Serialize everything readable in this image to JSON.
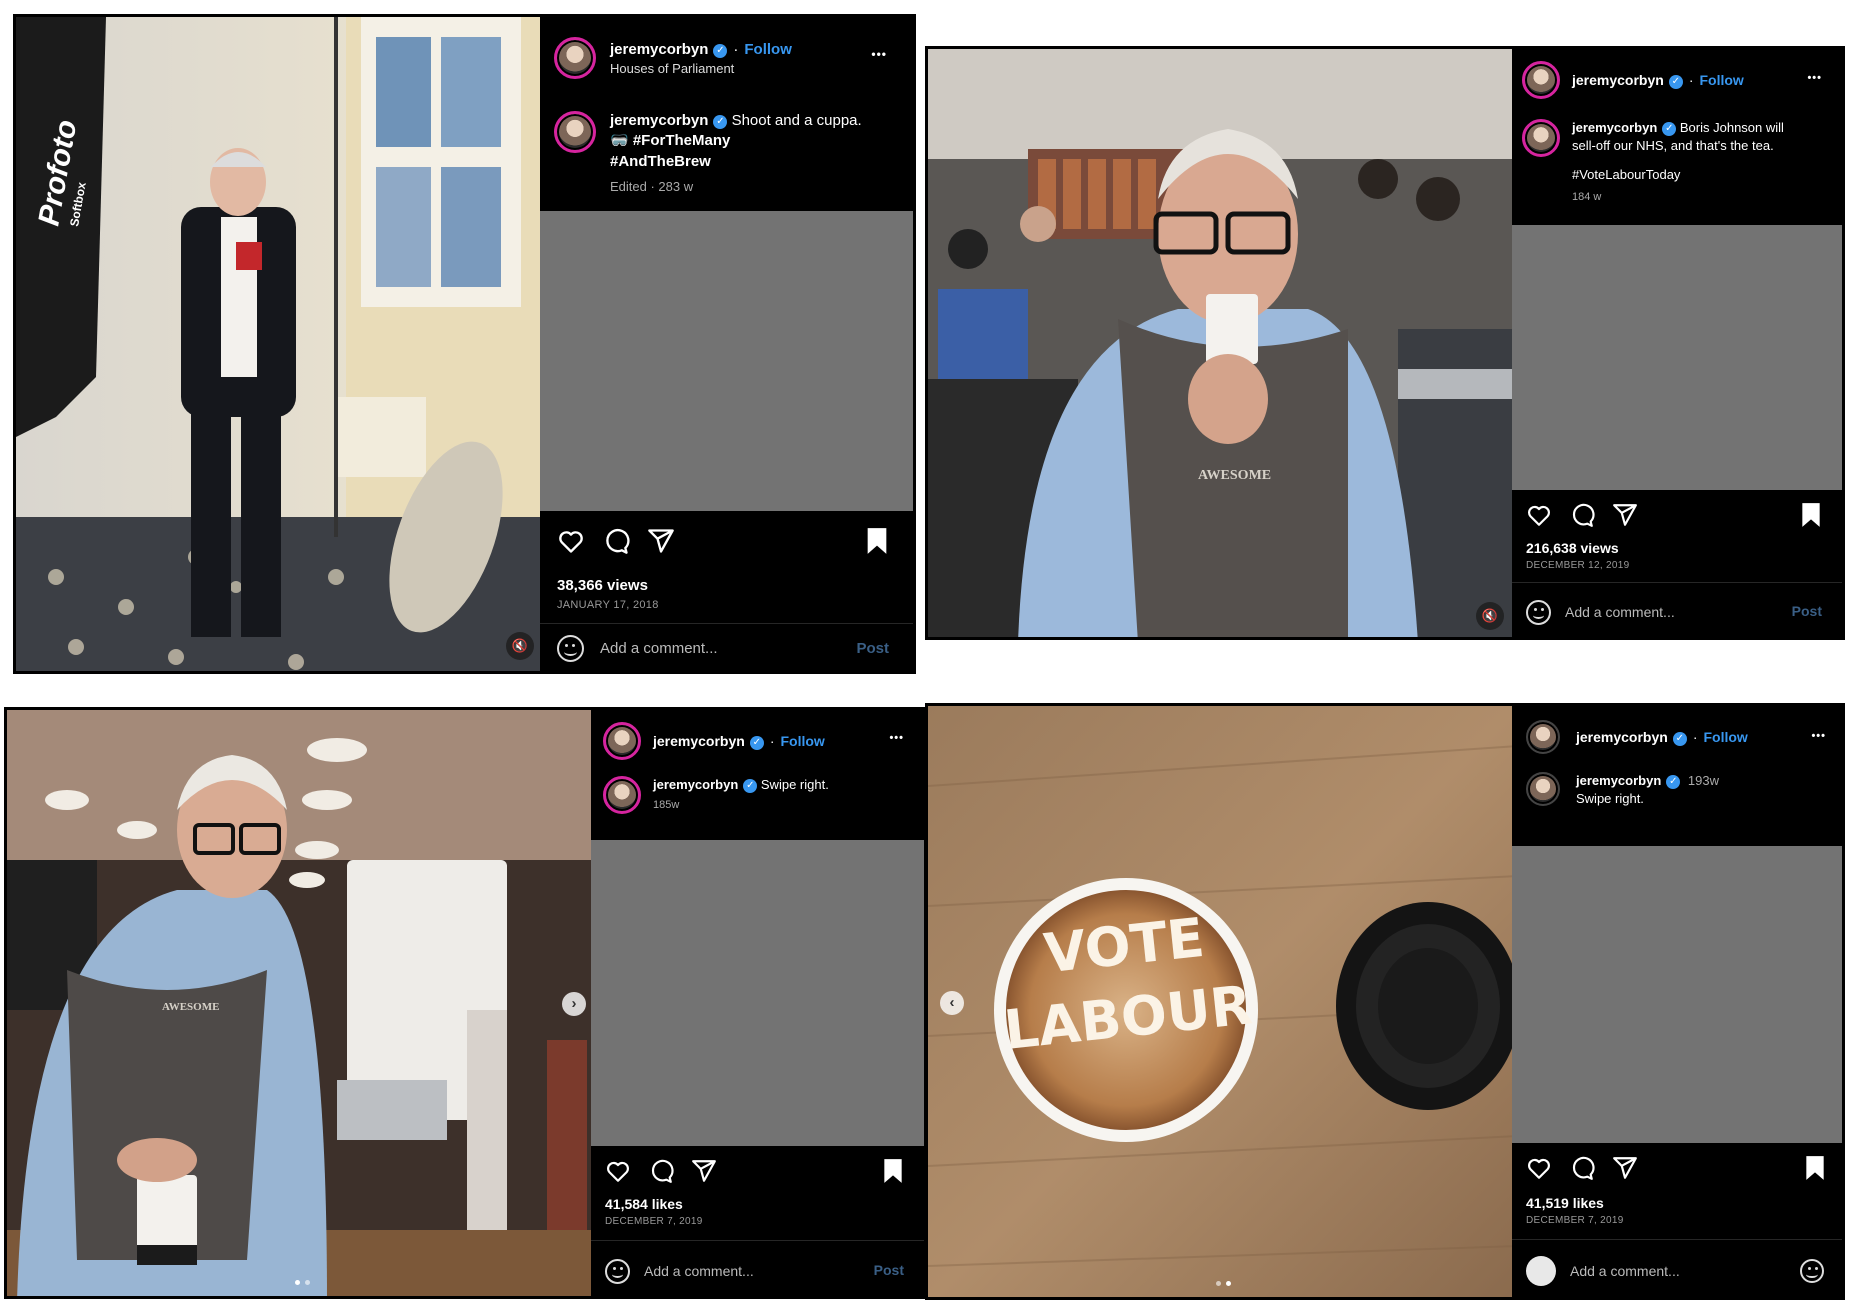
{
  "posts": [
    {
      "username": "jeremycorbyn",
      "follow_label": "Follow",
      "location": "Houses of Parliament",
      "more_label": "•••",
      "caption_lines": [
        "Shoot and a cuppa.",
        "🥽 #ForTheMany",
        "#AndTheBrew"
      ],
      "caption_meta": "Edited · 283 w",
      "stat": "38,366 views",
      "date": "JANUARY 17, 2018",
      "comment_placeholder": "Add a comment...",
      "post_label": "Post"
    },
    {
      "username": "jeremycorbyn",
      "follow_label": "Follow",
      "more_label": "•••",
      "caption_lines": [
        "Boris Johnson will",
        "sell-off our NHS, and that's the tea."
      ],
      "caption_hashtag": "#VoteLabourToday",
      "caption_meta": "184 w",
      "stat": "216,638 views",
      "date": "DECEMBER 12, 2019",
      "comment_placeholder": "Add a comment...",
      "post_label": "Post"
    },
    {
      "username": "jeremycorbyn",
      "follow_label": "Follow",
      "more_label": "•••",
      "caption_lines": [
        "Swipe right."
      ],
      "caption_meta": "185w",
      "stat": "41,584 likes",
      "date": "DECEMBER 7, 2019",
      "comment_placeholder": "Add a comment...",
      "post_label": "Post"
    },
    {
      "username": "jeremycorbyn",
      "follow_label": "Follow",
      "more_label": "•••",
      "caption_time": "193w",
      "caption_lines": [
        "Swipe right."
      ],
      "stat": "41,519 likes",
      "date": "DECEMBER 7, 2019",
      "comment_placeholder": "Add a comment..."
    }
  ],
  "photo_text": {
    "softbox_brand": "Profoto",
    "softbox_sub": "Softbox",
    "apron_logo": "AWESOME",
    "latte_line1": "VOTE",
    "latte_line2": "LABOUR"
  },
  "icons": {
    "like": "heart-icon",
    "comment": "comment-bubble-icon",
    "share": "paper-plane-icon",
    "save": "bookmark-icon",
    "emoji": "smiley-icon",
    "audio": "muted-speaker-icon",
    "verified": "verified-badge-icon"
  },
  "colors": {
    "link_blue": "#3897f0",
    "panel_black": "#000000",
    "empty_grey": "#737373"
  }
}
